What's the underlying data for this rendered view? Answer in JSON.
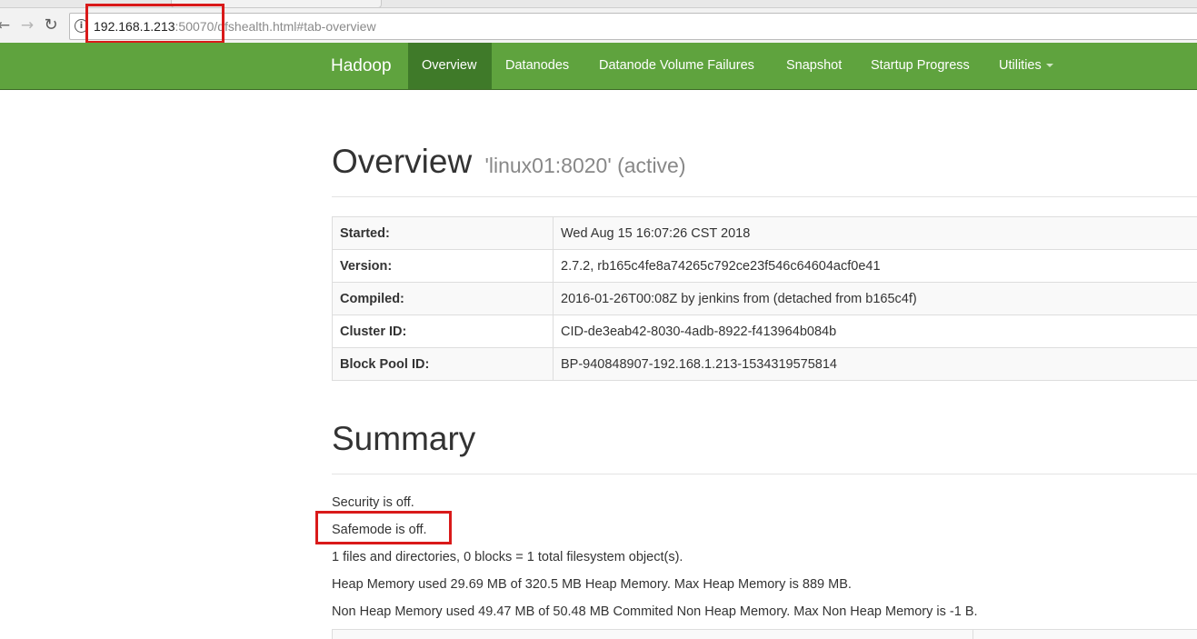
{
  "browser": {
    "url_host": "192.168.1.213",
    "url_port": ":50070",
    "url_path": "/dfshealth.html#tab-overview"
  },
  "navbar": {
    "brand": "Hadoop",
    "items": [
      {
        "label": "Overview",
        "active": true
      },
      {
        "label": "Datanodes"
      },
      {
        "label": "Datanode Volume Failures"
      },
      {
        "label": "Snapshot"
      },
      {
        "label": "Startup Progress"
      },
      {
        "label": "Utilities",
        "dropdown": true
      }
    ]
  },
  "overview": {
    "title": "Overview",
    "subtitle": "'linux01:8020' (active)",
    "rows": [
      {
        "key": "Started:",
        "value": "Wed Aug 15 16:07:26 CST 2018"
      },
      {
        "key": "Version:",
        "value": "2.7.2, rb165c4fe8a74265c792ce23f546c64604acf0e41"
      },
      {
        "key": "Compiled:",
        "value": "2016-01-26T00:08Z by jenkins from (detached from b165c4f)"
      },
      {
        "key": "Cluster ID:",
        "value": "CID-de3eab42-8030-4adb-8922-f413964b084b"
      },
      {
        "key": "Block Pool ID:",
        "value": "BP-940848907-192.168.1.213-1534319575814"
      }
    ]
  },
  "summary": {
    "title": "Summary",
    "lines": [
      "Security is off.",
      "Safemode is off.",
      "1 files and directories, 0 blocks = 1 total filesystem object(s).",
      "Heap Memory used 29.69 MB of 320.5 MB Heap Memory. Max Heap Memory is 889 MB.",
      "Non Heap Memory used 49.47 MB of 50.48 MB Commited Non Heap Memory. Max Non Heap Memory is -1 B."
    ]
  },
  "colors": {
    "navbar": "#5fa33e",
    "navbar_active": "#3f7a29",
    "highlight": "#d91a1a"
  }
}
